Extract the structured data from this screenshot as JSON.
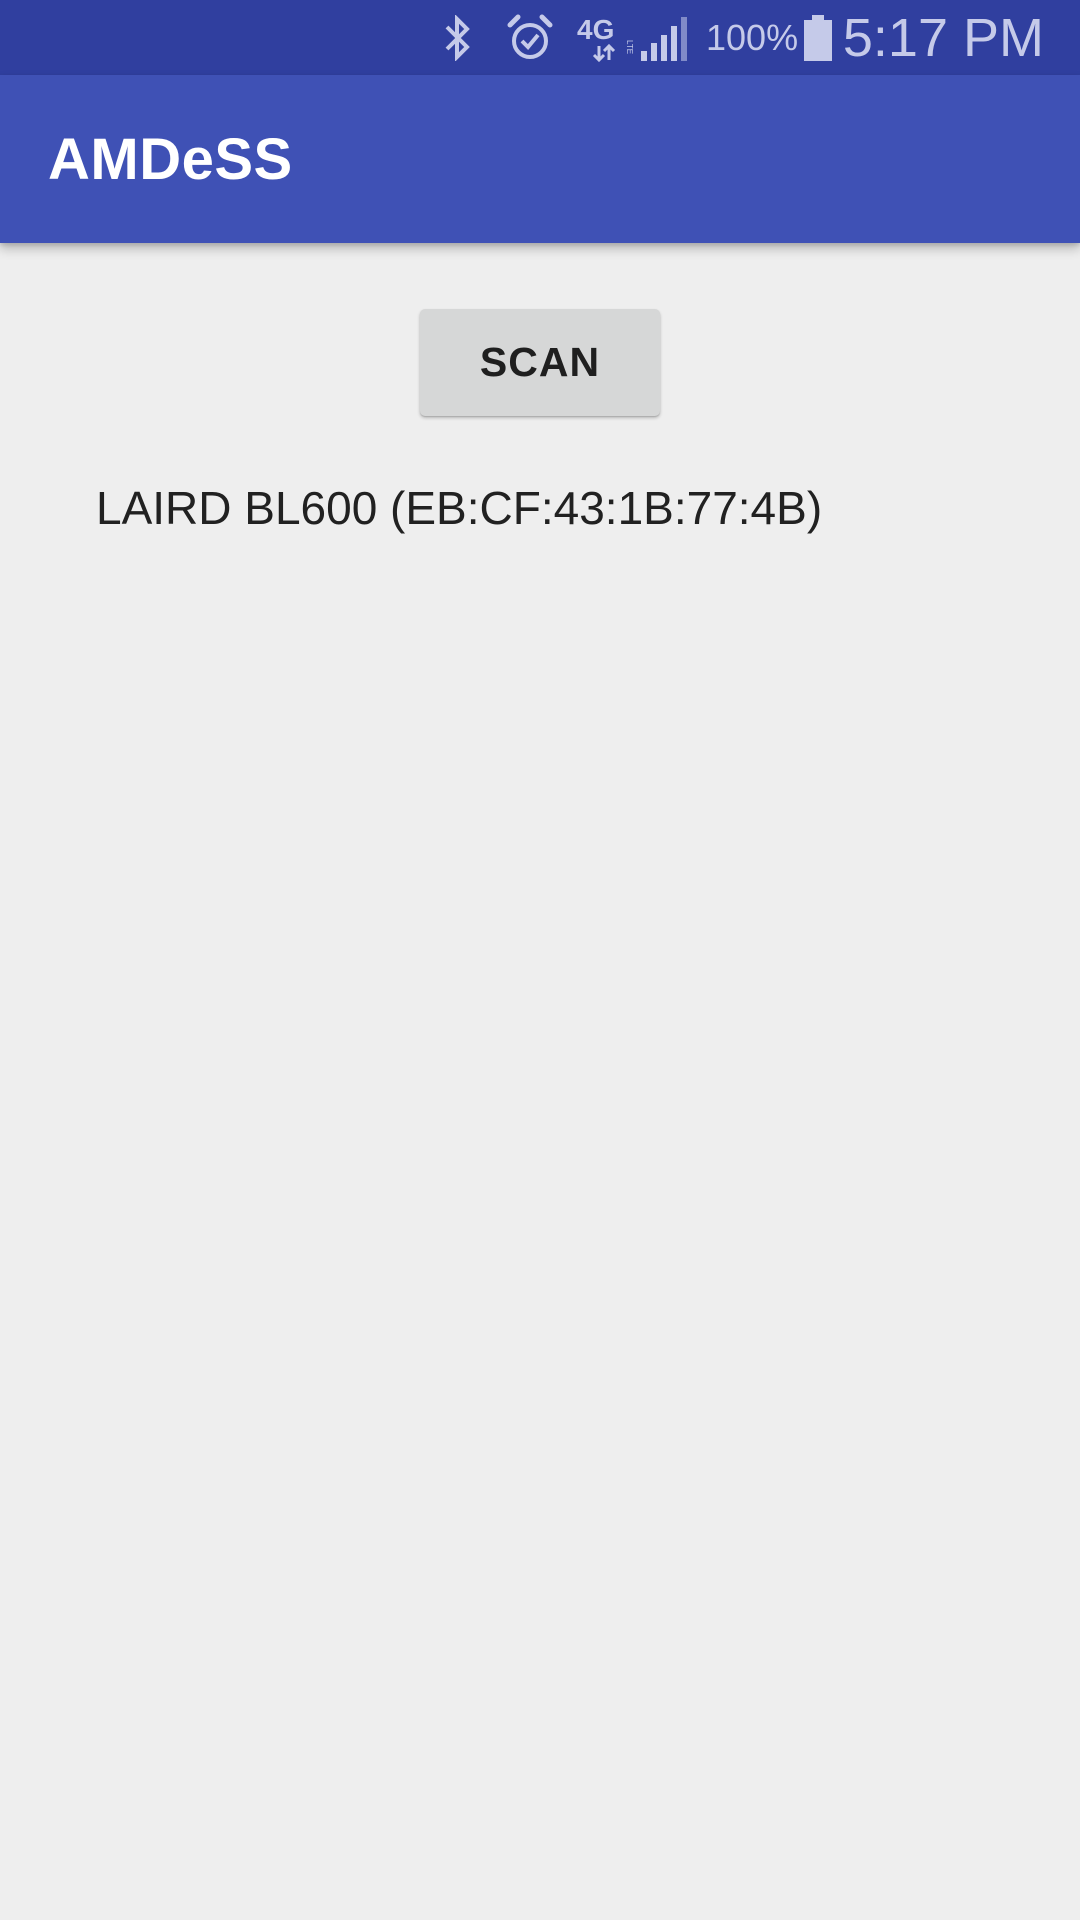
{
  "status_bar": {
    "icons": [
      "bluetooth-icon",
      "alarm-icon",
      "4g-lte-icon",
      "signal-icon",
      "battery-icon"
    ],
    "battery_percent": "100%",
    "time": "5:17 PM",
    "colors": {
      "background": "#303F9F",
      "foreground": "#C5CAE9"
    }
  },
  "app_bar": {
    "title": "AMDeSS",
    "color": "#3F51B5"
  },
  "main": {
    "scan_button_label": "SCAN",
    "devices": [
      {
        "label": "LAIRD BL600 (EB:CF:43:1B:77:4B)"
      }
    ]
  }
}
